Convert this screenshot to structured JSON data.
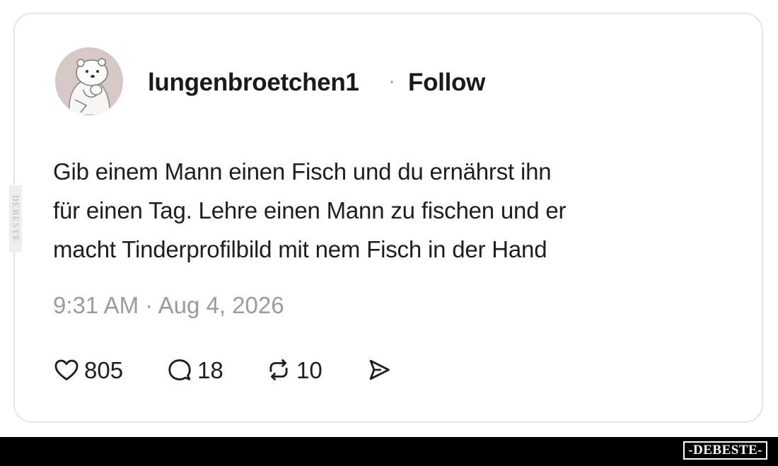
{
  "post": {
    "username": "lungenbroetchen1",
    "separator": "·",
    "follow_label": "Follow",
    "text_lines": [
      "Gib einem Mann einen Fisch und du ernährst ihn",
      "für einen Tag. Lehre einen Mann zu fischen und er",
      "macht Tinderprofilbild mit nem Fisch in der Hand"
    ],
    "timestamp": "9:31 AM · Aug 4, 2026",
    "actions": {
      "likes": {
        "icon": "heart-icon",
        "count": "805"
      },
      "comments": {
        "icon": "comment-icon",
        "count": "18"
      },
      "reposts": {
        "icon": "repost-icon",
        "count": "10"
      },
      "share": {
        "icon": "share-icon"
      }
    }
  },
  "watermark": {
    "bottom": "-DEBESTE-",
    "side": "DEBESTE"
  },
  "colors": {
    "text": "#1e1e1e",
    "muted": "#9b9b9b",
    "card_border": "#e6e6e6",
    "bar": "#000000"
  }
}
